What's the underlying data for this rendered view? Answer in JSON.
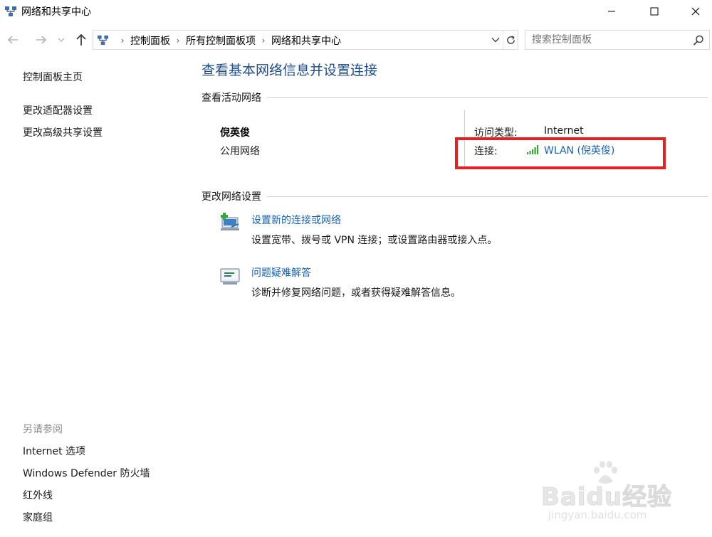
{
  "window": {
    "title": "网络和共享中心"
  },
  "address": {
    "breadcrumbs": [
      "控制面板",
      "所有控制面板项",
      "网络和共享中心"
    ]
  },
  "search": {
    "placeholder": "搜索控制面板"
  },
  "sidebar": {
    "home": "控制面板主页",
    "links": [
      "更改适配器设置",
      "更改高级共享设置"
    ],
    "see_also_heading": "另请参阅",
    "see_also": [
      "Internet 选项",
      "Windows Defender 防火墙",
      "红外线",
      "家庭组"
    ]
  },
  "main": {
    "title": "查看基本网络信息并设置连接",
    "active_networks_heading": "查看活动网络",
    "network": {
      "name": "倪英俊",
      "type": "公用网络",
      "access_label": "访问类型:",
      "access_value": "Internet",
      "connection_label": "连接:",
      "connection_value": "WLAN (倪英俊)"
    },
    "change_settings_heading": "更改网络设置",
    "tasks": [
      {
        "title": "设置新的连接或网络",
        "desc": "设置宽带、拨号或 VPN 连接；或设置路由器或接入点。",
        "icon": "new-connection-icon"
      },
      {
        "title": "问题疑难解答",
        "desc": "诊断并修复网络问题，或者获得疑难解答信息。",
        "icon": "troubleshoot-icon"
      }
    ]
  },
  "watermark": {
    "brand": "Baidu经验",
    "url": "jingyan.baidu.com"
  },
  "colors": {
    "title_blue": "#1e4e8c",
    "link_blue": "#1560b0",
    "highlight_red": "#e32121"
  }
}
